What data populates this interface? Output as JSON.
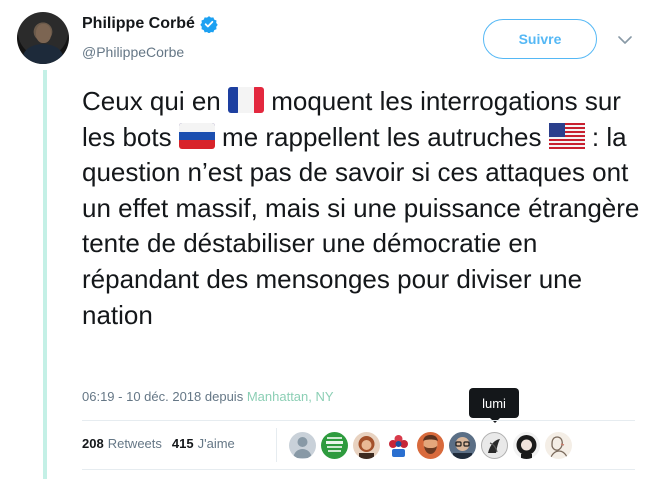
{
  "author": {
    "display_name": "Philippe Corbé",
    "handle": "@PhilippeCorbe",
    "verified": true
  },
  "follow_button": {
    "label": "Suivre"
  },
  "tweet": {
    "segments": [
      "Ceux qui en ",
      " moquent les interrogations sur les bots ",
      " me rappellent les autruches ",
      " : la question n’est pas de savoir si ces attaques ont un effet massif, mais si une puissance étrangère tente de déstabiliser une démocratie en répandant des mensonges pour diviser une nation"
    ],
    "flags": [
      "france-flag",
      "russia-flag",
      "usa-flag"
    ]
  },
  "meta": {
    "timestamp": "06:19 - 10 déc. 2018",
    "via": "depuis",
    "location": "Manhattan, NY"
  },
  "tooltip": {
    "text": "lumi"
  },
  "stats": {
    "retweets_count": "208",
    "retweets_label": "Retweets",
    "likes_count": "415",
    "likes_label": "J'aime"
  },
  "likers": [
    "default-avatar",
    "keep-calm-avatar",
    "woman-avatar",
    "flower-avatar",
    "bearded-man-avatar",
    "glasses-man-avatar",
    "lumi-avatar",
    "dark-hair-woman-avatar",
    "sketch-avatar"
  ],
  "colors": {
    "accent": "#1da1f2",
    "location": "#8ccfb5",
    "thread_line": "#c4f0e6",
    "muted": "#657786"
  }
}
